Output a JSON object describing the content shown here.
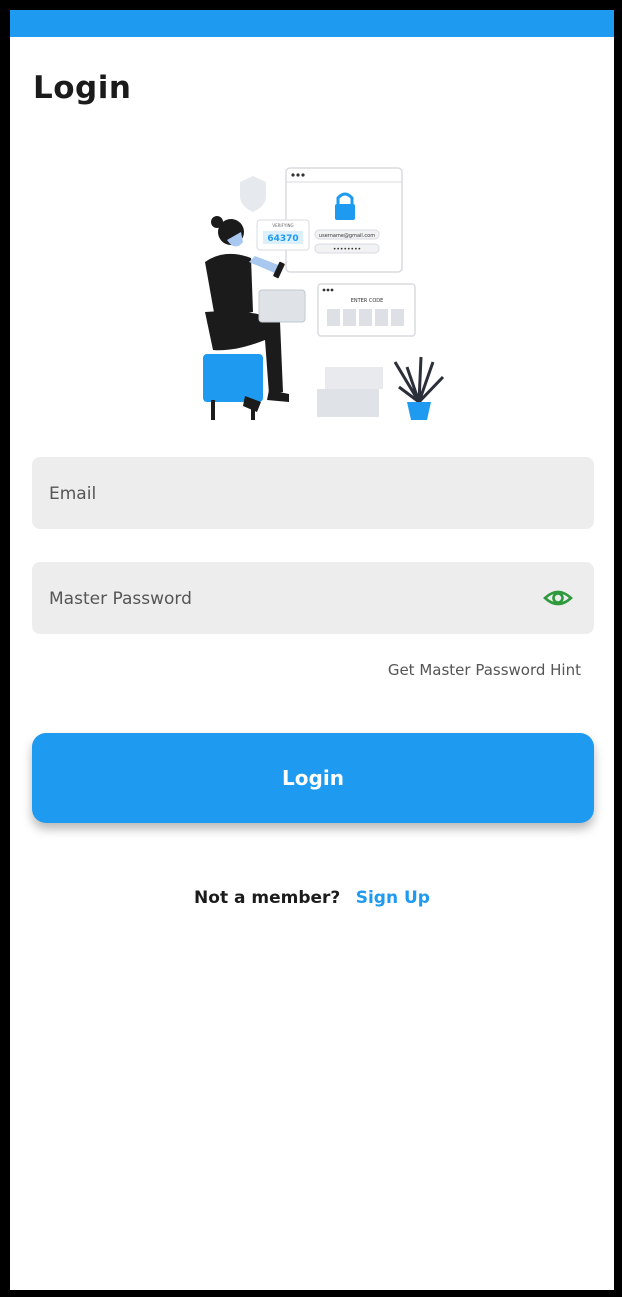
{
  "status_bar": {
    "color": "#1e9bf0"
  },
  "page": {
    "title": "Login"
  },
  "illustration": {
    "name": "security-login-illustration",
    "code_label": "VERIFYING",
    "code_value": "64370",
    "email_text": "username@gmail.com",
    "password_mask": "••••••••",
    "enter_code_label": "ENTER CODE"
  },
  "form": {
    "email": {
      "placeholder": "Email",
      "value": ""
    },
    "password": {
      "placeholder": "Master Password",
      "value": "",
      "toggle_icon": "eye-icon"
    },
    "hint_link": "Get Master Password Hint",
    "login_button": "Login"
  },
  "footer": {
    "question": "Not a member?",
    "signup_link": "Sign Up"
  },
  "colors": {
    "accent": "#1e9bf0",
    "eye_icon": "#2e9a3c",
    "field_bg": "#ededed"
  }
}
